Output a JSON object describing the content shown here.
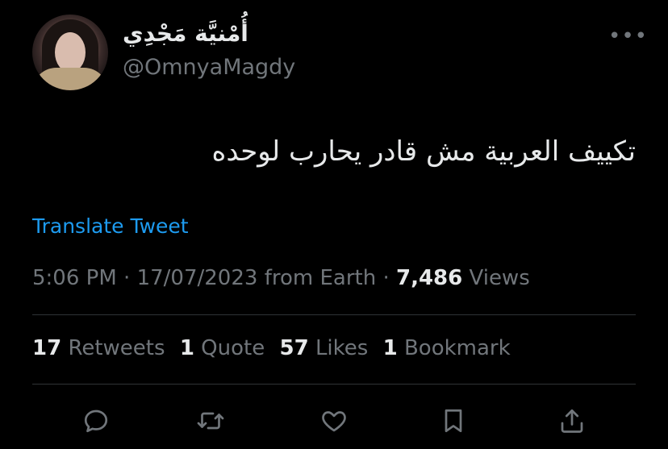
{
  "author": {
    "display_name": "أُمْنيَّة مَجْدِي",
    "handle": "@OmnyaMagdy"
  },
  "menu": {
    "more_label": "•••"
  },
  "tweet": {
    "text": "تكييف العربية مش قادر يحارب لوحده",
    "translate_label": "Translate Tweet",
    "time": "5:06 PM",
    "date": "17/07/2023",
    "source": "from Earth",
    "views_count": "7,486",
    "views_label": "Views"
  },
  "stats": {
    "retweets_count": "17",
    "retweets_label": "Retweets",
    "quotes_count": "1",
    "quotes_label": "Quote",
    "likes_count": "57",
    "likes_label": "Likes",
    "bookmarks_count": "1",
    "bookmarks_label": "Bookmark"
  },
  "actions": [
    "reply-icon",
    "retweet-icon",
    "like-icon",
    "bookmark-icon",
    "share-icon"
  ],
  "colors": {
    "background": "#000000",
    "primary_text": "#e7e9ea",
    "secondary_text": "#71767b",
    "link": "#1d9bf0",
    "divider": "#2f3336"
  }
}
